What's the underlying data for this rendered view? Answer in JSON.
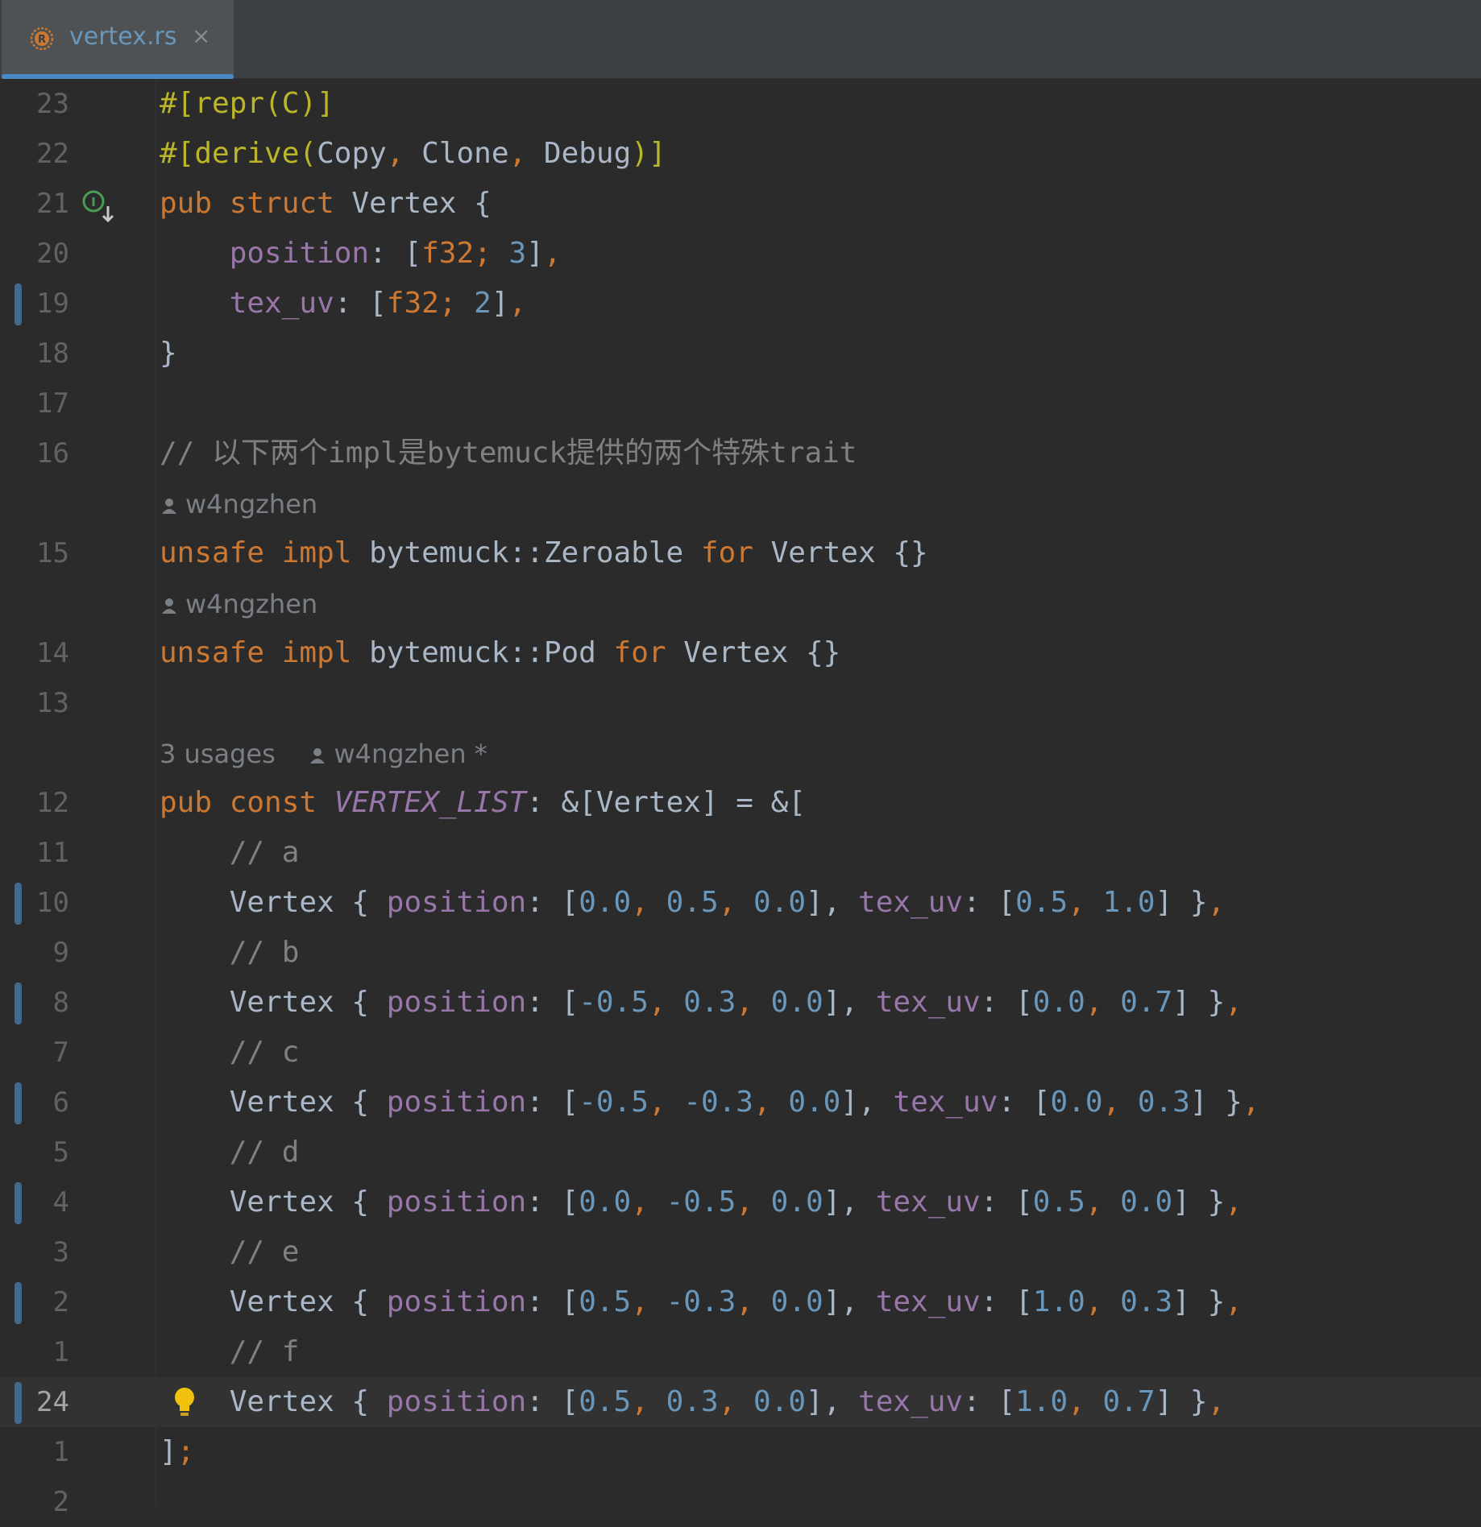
{
  "tab": {
    "filename": "vertex.rs",
    "close": "×"
  },
  "code": {
    "l1": {
      "num": "23",
      "attr_open": "#[",
      "attr_name": "repr",
      "attr_arg": "(C)",
      "attr_close": "]"
    },
    "l2": {
      "num": "22",
      "attr_open": "#[",
      "attr_name": "derive",
      "p_open": "(",
      "a1": "Copy",
      "c1": ", ",
      "a2": "Clone",
      "c2": ", ",
      "a3": "Debug",
      "p_close": ")",
      "attr_close": "]"
    },
    "l3": {
      "num": "21",
      "kw_pub": "pub ",
      "kw_struct": "struct ",
      "name": "Vertex {"
    },
    "l4": {
      "num": "20",
      "indent": "    ",
      "field": "position",
      "colon": ": [",
      "type": "f32;",
      "sp": " ",
      "n": "3",
      "close": "]",
      "comma": ","
    },
    "l5": {
      "num": "19",
      "indent": "    ",
      "field": "tex_uv",
      "colon": ": [",
      "type": "f32;",
      "sp": " ",
      "n": "2",
      "close": "]",
      "comma": ","
    },
    "l6": {
      "num": "18",
      "text": "}"
    },
    "l7": {
      "num": "17"
    },
    "l8": {
      "num": "16",
      "comment": "// 以下两个impl是bytemuck提供的两个特殊trait"
    },
    "a1": {
      "author": "w4ngzhen"
    },
    "l9": {
      "num": "15",
      "kw_unsafe": "unsafe ",
      "kw_impl": "impl ",
      "path": "bytemuck::Zeroable ",
      "kw_for": "for ",
      "rest": "Vertex {}"
    },
    "a2": {
      "author": "w4ngzhen"
    },
    "l10": {
      "num": "14",
      "kw_unsafe": "unsafe ",
      "kw_impl": "impl ",
      "path": "bytemuck::Pod ",
      "kw_for": "for ",
      "rest": "Vertex {}"
    },
    "l11": {
      "num": "13"
    },
    "a3": {
      "usages": "3 usages",
      "author": "w4ngzhen *"
    },
    "l12": {
      "num": "12",
      "kw_pub": "pub ",
      "kw_const": "const ",
      "name": "VERTEX_LIST",
      "rest": ": &[Vertex] = &["
    },
    "l13": {
      "num": "11",
      "comment": "    // a"
    },
    "v1": {
      "num": "10",
      "p": [
        "0.0",
        "0.5",
        "0.0"
      ],
      "t": [
        "0.5",
        "1.0"
      ]
    },
    "l15": {
      "num": "9",
      "comment": "    // b"
    },
    "v2": {
      "num": "8",
      "p": [
        "-0.5",
        "0.3",
        "0.0"
      ],
      "t": [
        "0.0",
        "0.7"
      ]
    },
    "l17": {
      "num": "7",
      "comment": "    // c"
    },
    "v3": {
      "num": "6",
      "p": [
        "-0.5",
        "-0.3",
        "0.0"
      ],
      "t": [
        "0.0",
        "0.3"
      ]
    },
    "l19": {
      "num": "5",
      "comment": "    // d"
    },
    "v4": {
      "num": "4",
      "p": [
        "0.0",
        "-0.5",
        "0.0"
      ],
      "t": [
        "0.5",
        "0.0"
      ]
    },
    "l21": {
      "num": "3",
      "comment": "    // e"
    },
    "v5": {
      "num": "2",
      "p": [
        "0.5",
        "-0.3",
        "0.0"
      ],
      "t": [
        "1.0",
        "0.3"
      ]
    },
    "l23": {
      "num": "1",
      "comment": "    // f"
    },
    "v6": {
      "num": "24",
      "p": [
        "0.5",
        "0.3",
        "0.0"
      ],
      "t": [
        "1.0",
        "0.7"
      ]
    },
    "l25": {
      "num": "1",
      "close": "]",
      "semi": ";"
    },
    "l26": {
      "num": "2"
    },
    "vertex_tokens": {
      "indent": "    ",
      "name": "Vertex { ",
      "field_pos": "position",
      "colon_open": ": [",
      "comma": ", ",
      "close_comma": "], ",
      "field_tex": "tex_uv",
      "end": "] }",
      "trail": ","
    }
  },
  "colors": {
    "background": "#2b2b2b",
    "keyword": "#cc7832",
    "attribute": "#bbb529",
    "field": "#9876aa",
    "number": "#6897bb",
    "comment": "#808080",
    "text": "#a9b7c6",
    "change_marker": "#43698d",
    "tab_accent": "#4a88c7"
  },
  "icons": [
    "rust-file-icon",
    "close-icon",
    "implementations-icon",
    "person-icon",
    "lightbulb-icon"
  ]
}
